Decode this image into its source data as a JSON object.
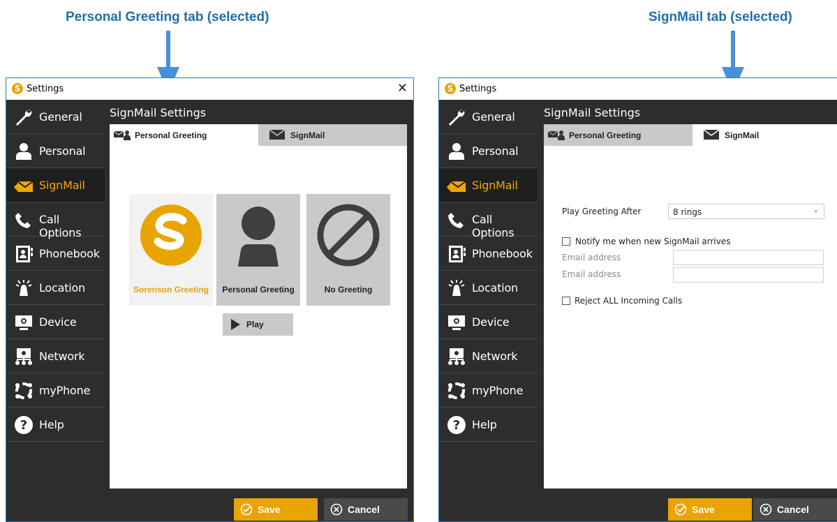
{
  "callouts": {
    "left": "Personal Greeting tab (selected)",
    "right": "SignMail tab (selected)"
  },
  "window": {
    "title": "Settings",
    "close_glyph": "✕"
  },
  "sidebar": {
    "items": [
      {
        "label": "General",
        "icon": "wrench-icon"
      },
      {
        "label": "Personal",
        "icon": "person-icon"
      },
      {
        "label": "SignMail",
        "icon": "signmail-icon",
        "active": true
      },
      {
        "label": "Call Options",
        "icon": "call-options-icon"
      },
      {
        "label": "Phonebook",
        "icon": "phonebook-icon"
      },
      {
        "label": "Location",
        "icon": "location-icon"
      },
      {
        "label": "Device",
        "icon": "device-icon"
      },
      {
        "label": "Network",
        "icon": "network-icon"
      },
      {
        "label": "myPhone",
        "icon": "myphone-icon"
      },
      {
        "label": "Help",
        "icon": "help-icon"
      }
    ]
  },
  "panel": {
    "title": "SignMail Settings",
    "tabs": {
      "personal_greeting": "Personal Greeting",
      "signmail": "SignMail"
    }
  },
  "greetings": {
    "cards": [
      {
        "label": "Sorenson Greeting",
        "icon": "sorenson-logo-icon",
        "selected": true
      },
      {
        "label": "Personal Greeting",
        "icon": "person-silhouette-icon"
      },
      {
        "label": "No Greeting",
        "icon": "no-symbol-icon"
      }
    ],
    "play_label": "Play"
  },
  "signmail_form": {
    "play_greeting_after_label": "Play Greeting After",
    "play_greeting_after_value": "8 rings",
    "notify_label": "Notify me when new SignMail arrives",
    "notify_checked": false,
    "email_label_1": "Email address",
    "email_value_1": "",
    "email_label_2": "Email address",
    "email_value_2": "",
    "reject_label": "Reject ALL Incoming Calls",
    "reject_checked": false
  },
  "footer": {
    "save_label": "Save",
    "cancel_label": "Cancel"
  },
  "colors": {
    "accent": "#f0a800",
    "sidebar_bg": "#2d2d2d",
    "callout": "#1f6fae",
    "arrow": "#4a90d9"
  }
}
